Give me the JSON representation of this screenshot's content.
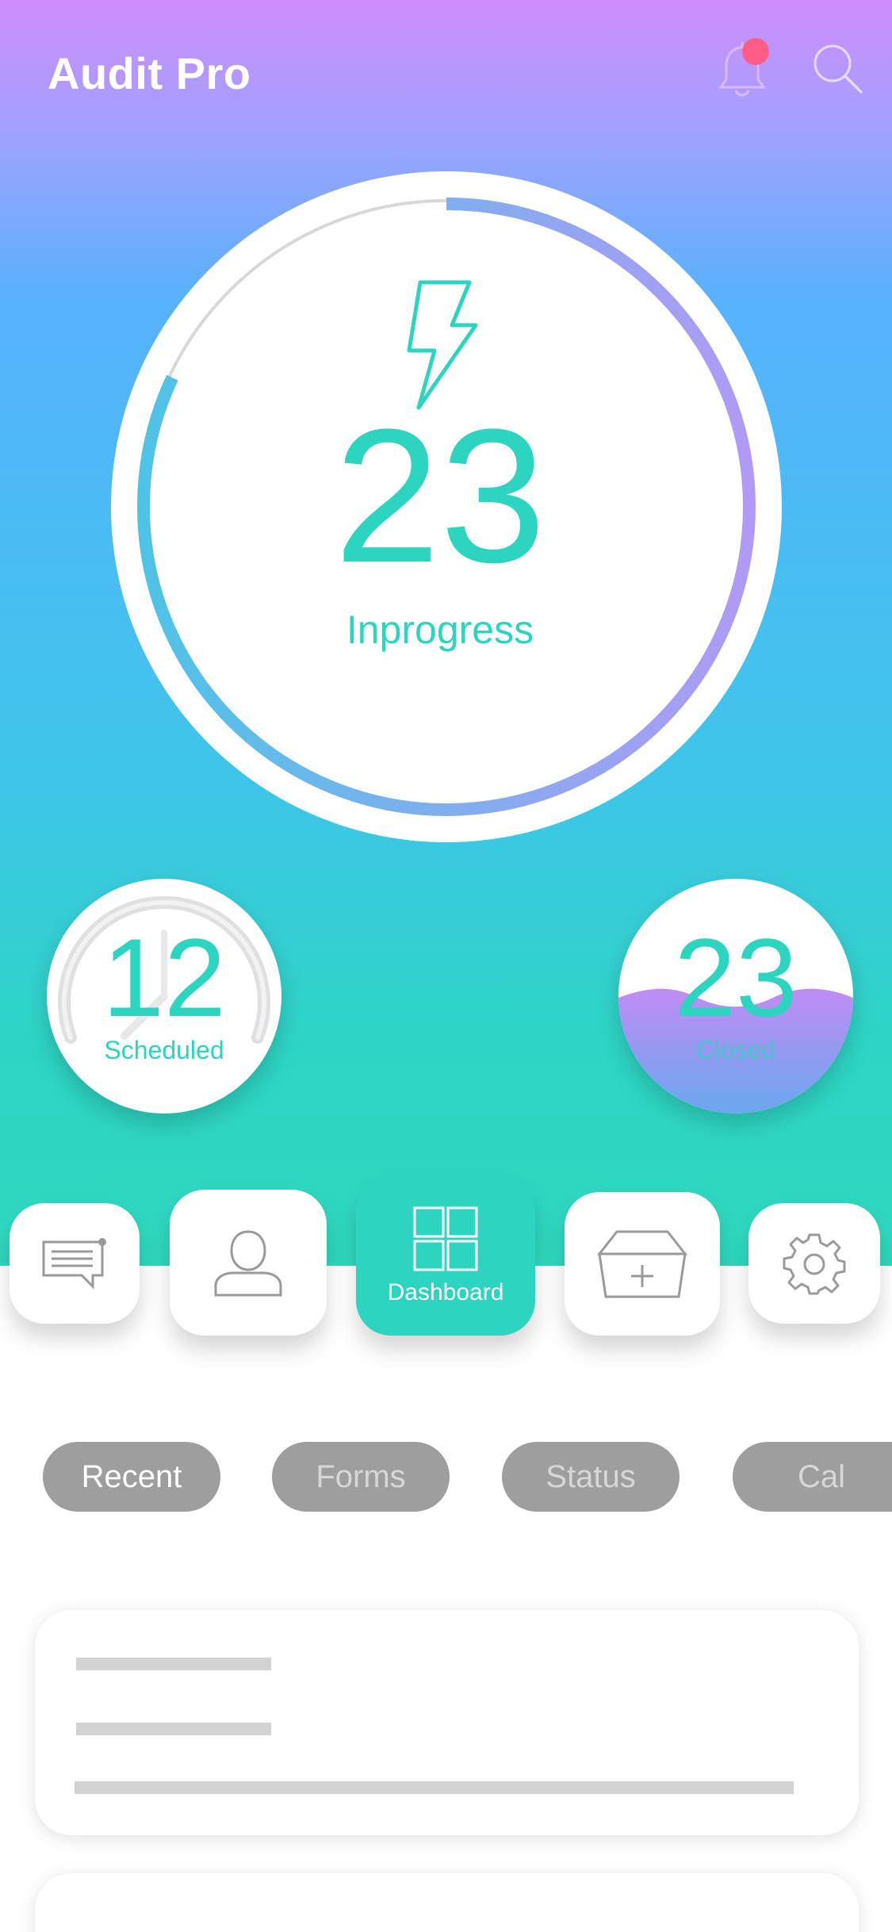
{
  "header": {
    "title": "Audit Pro",
    "icons": [
      "bell-icon",
      "search-icon"
    ],
    "notification_dot_color": "#ff5d86"
  },
  "progress": {
    "count": "23",
    "label": "Inprogress",
    "fraction_complete": 0.82,
    "icon": "lightning-bolt-icon"
  },
  "stats": {
    "scheduled": {
      "count": "12",
      "label": "Scheduled"
    },
    "closed": {
      "count": "23",
      "label": "Closed"
    }
  },
  "nav": {
    "items": [
      {
        "icon": "message-icon",
        "label": ""
      },
      {
        "icon": "user-icon",
        "label": ""
      },
      {
        "icon": "dashboard-grid-icon",
        "label": "Dashboard",
        "active": true
      },
      {
        "icon": "add-inbox-icon",
        "label": ""
      },
      {
        "icon": "gear-icon",
        "label": ""
      }
    ]
  },
  "tabs": [
    {
      "label": "Recent",
      "active": true
    },
    {
      "label": "Forms"
    },
    {
      "label": "Status"
    },
    {
      "label": "Cal"
    }
  ],
  "colors": {
    "accent": "#2dd4bf",
    "gradient_top": "#cf8dfd",
    "gradient_bottom": "#2fd8bd",
    "ring_gradient_start": "#4fc3e6",
    "ring_gradient_end": "#b09af5",
    "pill_bg": "#9e9e9e"
  }
}
